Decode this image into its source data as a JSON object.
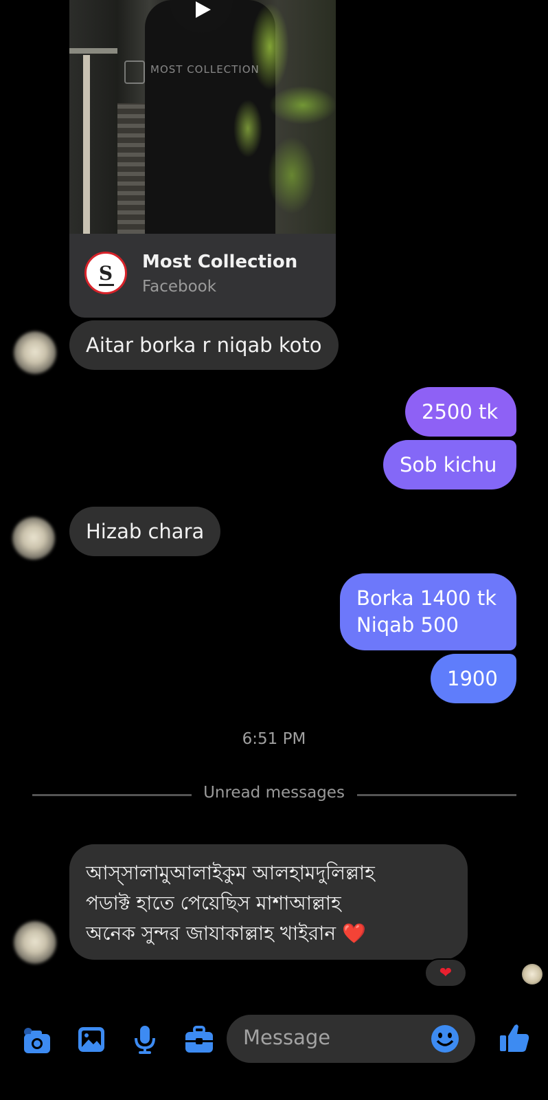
{
  "shared_post": {
    "page_name": "Most Collection",
    "source": "Facebook",
    "watermark": "MOST COLLECTION"
  },
  "messages": [
    {
      "side": "in",
      "text": "Aitar borka r niqab koto"
    },
    {
      "side": "out",
      "text": "2500 tk"
    },
    {
      "side": "out",
      "text": "Sob kichu"
    },
    {
      "side": "in",
      "text": "Hizab chara"
    },
    {
      "side": "out",
      "text": "Borka 1400 tk\nNiqab 500"
    },
    {
      "side": "out",
      "text": "1900"
    }
  ],
  "timestamp": "6:51 PM",
  "divider": {
    "label": "Unread messages"
  },
  "unread_message": {
    "lines": [
      "আস্সালামুআলাইকুম আলহামদুলিল্লাহ",
      "পডাক্ট হাতে পেয়েছিস মাশাআল্লাহ",
      "অনেক সুন্দর জাযাকাল্লাহ খাইরান ❤️"
    ]
  },
  "reaction": "❤",
  "composer": {
    "placeholder": "Message",
    "icons": [
      "camera-icon",
      "gallery-icon",
      "microphone-icon",
      "briefcase-icon",
      "emoji-icon",
      "thumbs-up-icon"
    ]
  },
  "colors": {
    "background": "#000000",
    "incoming_bubble": "#303030",
    "outgoing_top": "#8e61f5",
    "outgoing_bottom": "#5f7dfb",
    "accent": "#3d8bf2"
  }
}
